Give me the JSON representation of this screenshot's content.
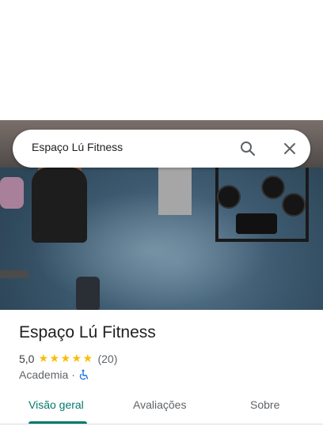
{
  "search": {
    "value": "Espaço Lú Fitness"
  },
  "place": {
    "name": "Espaço Lú Fitness",
    "rating": "5,0",
    "star_count": 5,
    "reviews": "(20)",
    "category": "Academia",
    "separator": "·",
    "accessibility_icon": "wheelchair-icon"
  },
  "tabs": [
    {
      "label": "Visão geral",
      "active": true
    },
    {
      "label": "Avaliações",
      "active": false
    },
    {
      "label": "Sobre",
      "active": false
    }
  ],
  "colors": {
    "accent": "#00796b",
    "star": "#fbbc04",
    "accessibility": "#1a73e8"
  }
}
